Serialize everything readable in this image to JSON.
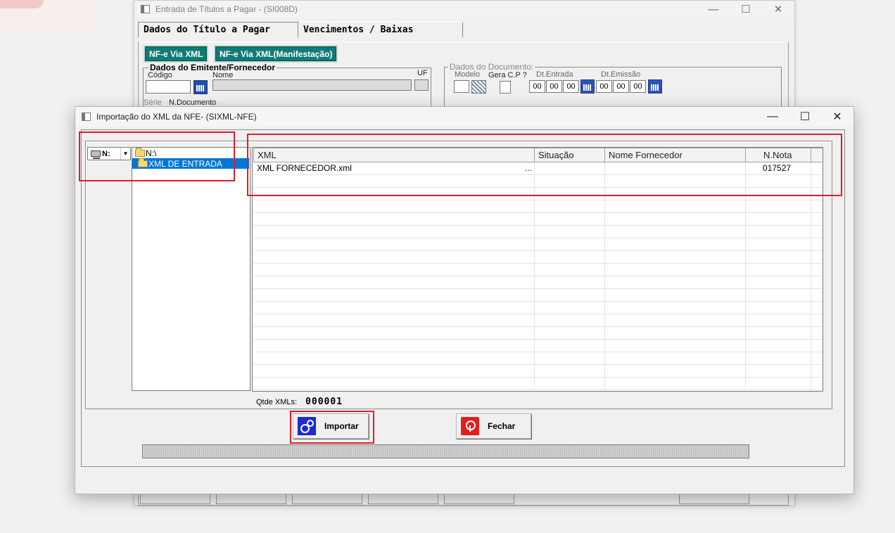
{
  "background_window": {
    "title": "Entrada de Títulos a Pagar - (SI008D)",
    "tabs": [
      {
        "label": "Dados do Título a Pagar"
      },
      {
        "label": "Vencimentos / Baixas"
      }
    ],
    "buttons": {
      "nfe_xml": "NF-e Via XML",
      "nfe_xml_manifest": "NF-e Via XML(Manifestação)"
    },
    "emitente_group": {
      "title": "Dados do Emitente/Fornecedor",
      "codigo_label": "Código",
      "nome_label": "Nome",
      "uf_label": "UF",
      "serie_label": "Série",
      "ndoc_label": "N.Documento"
    },
    "documento_group": {
      "title": "Dados do Documento:",
      "modelo_label": "Modelo",
      "gera_cp_label": "Gera C.P ?",
      "dt_entrada_label": "Dt.Entrada",
      "dt_emissao_label": "Dt.Emissão",
      "date_placeholder": "00"
    }
  },
  "dialog": {
    "title": "Importação do XML da NFE- (SIXML-NFE)",
    "drive": {
      "value": "N:"
    },
    "directories": [
      {
        "label": "N:\\",
        "selected": false
      },
      {
        "label": "XML DE ENTRADA",
        "selected": true
      }
    ],
    "grid": {
      "columns": [
        "XML",
        "Situação",
        "Nome Fornecedor",
        "N.Nota"
      ],
      "rows": [
        {
          "xml": "XML FORNECEDOR.xml",
          "ellipsis": "...",
          "situacao": "",
          "fornecedor": "",
          "nota": "017527"
        }
      ]
    },
    "qtde_label": "Qtde XMLs:",
    "qtde_value": "000001",
    "buttons": {
      "importar": "Importar",
      "fechar": "Fechar"
    }
  }
}
